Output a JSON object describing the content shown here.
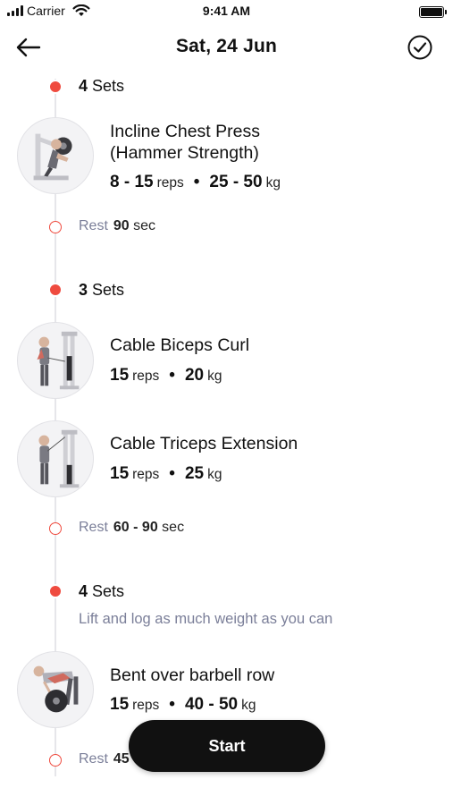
{
  "status_bar": {
    "carrier": "Carrier",
    "time": "9:41 AM"
  },
  "header": {
    "title": "Sat, 24 Jun",
    "back_icon": "arrow-left-icon",
    "done_icon": "check-circle-icon"
  },
  "accent_color": "#ef4b3f",
  "groups": [
    {
      "sets_count": "4",
      "sets_word": "Sets",
      "exercises": [
        {
          "name_line1": "Incline Chest Press",
          "name_line2": "(Hammer Strength)",
          "reps": "8 - 15",
          "reps_unit": "reps",
          "weight": "25 - 50",
          "weight_unit": "kg"
        }
      ],
      "rest_label": "Rest",
      "rest_value": "90",
      "rest_unit": "sec"
    },
    {
      "sets_count": "3",
      "sets_word": "Sets",
      "exercises": [
        {
          "name": "Cable Biceps Curl",
          "reps": "15",
          "reps_unit": "reps",
          "weight": "20",
          "weight_unit": "kg"
        },
        {
          "name": "Cable Triceps Extension",
          "reps": "15",
          "reps_unit": "reps",
          "weight": "25",
          "weight_unit": "kg"
        }
      ],
      "rest_label": "Rest",
      "rest_value": "60 - 90",
      "rest_unit": "sec"
    },
    {
      "sets_count": "4",
      "sets_word": "Sets",
      "note": "Lift and log as much weight as you can",
      "exercises": [
        {
          "name": "Bent over barbell row",
          "reps": "15",
          "reps_unit": "reps",
          "weight": "40 - 50",
          "weight_unit": "kg"
        }
      ],
      "rest_label": "Rest",
      "rest_value_partial": "45"
    }
  ],
  "start_button": {
    "label": "Start"
  }
}
